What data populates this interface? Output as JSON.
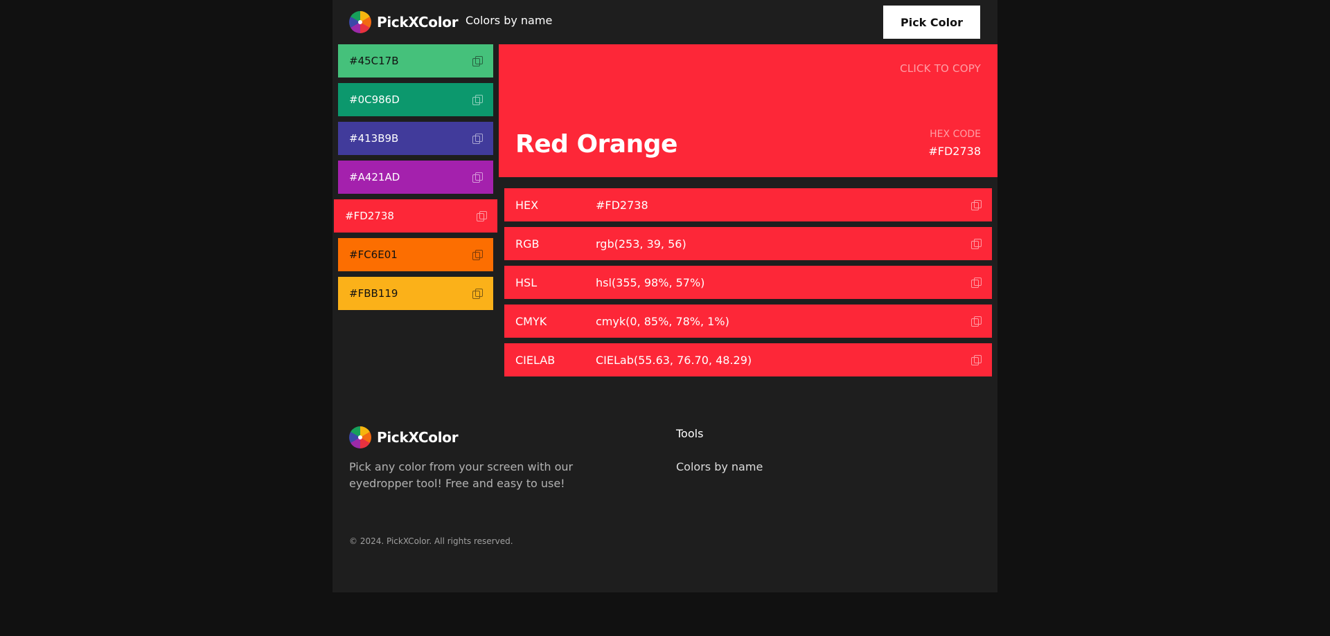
{
  "header": {
    "brand": "PickXColor",
    "nav_link": "Colors by name",
    "pick_button": "Pick Color"
  },
  "swatches": [
    {
      "hex": "#45C17B",
      "color": "#45C17B",
      "text_color": "#111111"
    },
    {
      "hex": "#0C986D",
      "color": "#0C986D",
      "text_color": "#ffffff"
    },
    {
      "hex": "#413B9B",
      "color": "#413B9B",
      "text_color": "#ffffff"
    },
    {
      "hex": "#A421AD",
      "color": "#A421AD",
      "text_color": "#ffffff"
    },
    {
      "hex": "#FD2738",
      "color": "#FD2738",
      "text_color": "#ffffff",
      "active": true
    },
    {
      "hex": "#FC6E01",
      "color": "#FC6E01",
      "text_color": "#111111"
    },
    {
      "hex": "#FBB119",
      "color": "#FBB119",
      "text_color": "#111111"
    }
  ],
  "hero": {
    "click_to_copy": "CLICK TO COPY",
    "name": "Red Orange",
    "hex_label": "HEX CODE",
    "hex_value": "#FD2738",
    "color": "#FD2738"
  },
  "formats": [
    {
      "label": "HEX",
      "value": "#FD2738"
    },
    {
      "label": "RGB",
      "value": "rgb(253, 39, 56)"
    },
    {
      "label": "HSL",
      "value": "hsl(355, 98%, 57%)"
    },
    {
      "label": "CMYK",
      "value": "cmyk(0, 85%, 78%, 1%)"
    },
    {
      "label": "CIELAB",
      "value": "CIELab(55.63, 76.70, 48.29)"
    }
  ],
  "footer": {
    "brand": "PickXColor",
    "description": "Pick any color from your screen with our eyedropper tool! Free and easy to use!",
    "tools_heading": "Tools",
    "tools_link": "Colors by name",
    "copyright": "© 2024. PickXColor. All rights reserved."
  }
}
